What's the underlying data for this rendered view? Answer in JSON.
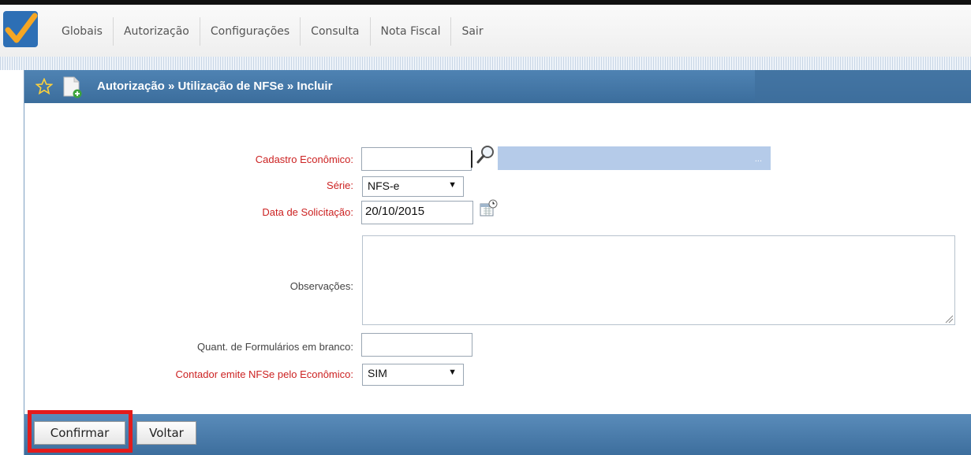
{
  "menu": {
    "items": [
      "Globais",
      "Autorização",
      "Configurações",
      "Consulta",
      "Nota Fiscal",
      "Sair"
    ]
  },
  "panel": {
    "title": "Autorização » Utilização de NFSe » Incluir"
  },
  "form": {
    "cadastro_label": "Cadastro Econômico:",
    "cadastro_value": "",
    "cadastro_desc_value": "...",
    "serie_label": "Série:",
    "serie_value": "NFS-e",
    "data_label": "Data de Solicitação:",
    "data_value": "20/10/2015",
    "obs_label": "Observações:",
    "obs_value": "",
    "quant_label": "Quant. de Formulários em branco:",
    "quant_value": "",
    "contador_label": "Contador emite NFSe pelo Econômico:",
    "contador_value": "SIM"
  },
  "actions": {
    "confirm_label": "Confirmar",
    "back_label": "Voltar"
  },
  "colors": {
    "header_blue": "#4f83b3",
    "required_red": "#cc2222",
    "highlight_red": "#e31b1b"
  },
  "icons": [
    "app-logo-icon",
    "star-icon",
    "document-add-icon",
    "search-icon",
    "calendar-icon",
    "dropdown-arrow-icon",
    "resize-handle-icon"
  ]
}
